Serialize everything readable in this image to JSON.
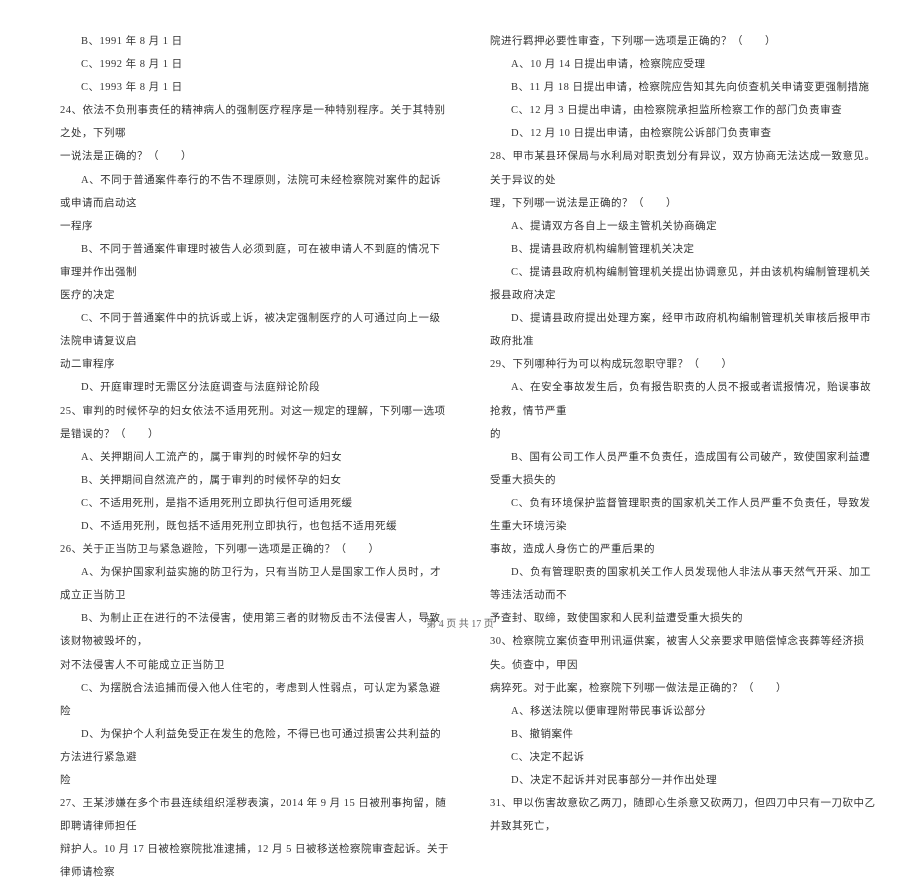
{
  "left_column": {
    "lines": [
      {
        "text": "B、1991 年 8 月 1 日",
        "indent": 1
      },
      {
        "text": "C、1992 年 8 月 1 日",
        "indent": 1
      },
      {
        "text": "C、1993 年 8 月 1 日",
        "indent": 1
      },
      {
        "text": "24、依法不负刑事责任的精神病人的强制医疗程序是一种特别程序。关于其特别之处，下列哪",
        "indent": 2
      },
      {
        "text": "一说法是正确的？（　　）",
        "indent": 2
      },
      {
        "text": "A、不同于普通案件奉行的不告不理原则，法院可未经检察院对案件的起诉或申请而启动这",
        "indent": 1
      },
      {
        "text": "一程序",
        "indent": 2
      },
      {
        "text": "B、不同于普通案件审理时被告人必须到庭，可在被申请人不到庭的情况下审理并作出强制",
        "indent": 1
      },
      {
        "text": "医疗的决定",
        "indent": 2
      },
      {
        "text": "C、不同于普通案件中的抗诉或上诉，被决定强制医疗的人可通过向上一级法院申请复议启",
        "indent": 1
      },
      {
        "text": "动二审程序",
        "indent": 2
      },
      {
        "text": "D、开庭审理时无需区分法庭调查与法庭辩论阶段",
        "indent": 1
      },
      {
        "text": "25、审判的时候怀孕的妇女依法不适用死刑。对这一规定的理解，下列哪一选项是错误的？（　　）",
        "indent": 2
      },
      {
        "text": "A、关押期间人工流产的，属于审判的时候怀孕的妇女",
        "indent": 1
      },
      {
        "text": "B、关押期间自然流产的，属于审判的时候怀孕的妇女",
        "indent": 1
      },
      {
        "text": "C、不适用死刑，是指不适用死刑立即执行但可适用死缓",
        "indent": 1
      },
      {
        "text": "D、不适用死刑，既包括不适用死刑立即执行，也包括不适用死缓",
        "indent": 1
      },
      {
        "text": "26、关于正当防卫与紧急避险，下列哪一选项是正确的？（　　）",
        "indent": 2
      },
      {
        "text": "A、为保护国家利益实施的防卫行为，只有当防卫人是国家工作人员时，才成立正当防卫",
        "indent": 1
      },
      {
        "text": "B、为制止正在进行的不法侵害，使用第三者的财物反击不法侵害人，导致该财物被毁坏的，",
        "indent": 1
      },
      {
        "text": "对不法侵害人不可能成立正当防卫",
        "indent": 2
      },
      {
        "text": "C、为摆脱合法追捕而侵入他人住宅的，考虑到人性弱点，可认定为紧急避险",
        "indent": 1
      },
      {
        "text": "D、为保护个人利益免受正在发生的危险，不得已也可通过损害公共利益的方法进行紧急避",
        "indent": 1
      },
      {
        "text": "险",
        "indent": 2
      },
      {
        "text": "27、王某涉嫌在多个市县连续组织淫秽表演，2014 年 9 月 15 日被刑事拘留，随即聘请律师担任",
        "indent": 2
      },
      {
        "text": "辩护人。10 月 17 日被检察院批准逮捕，12 月 5 日被移送检察院审查起诉。关于律师请检察",
        "indent": 2
      }
    ]
  },
  "right_column": {
    "lines": [
      {
        "text": "院进行羁押必要性审查，下列哪一选项是正确的？（　　）",
        "indent": 2
      },
      {
        "text": "A、10 月 14 日提出申请，检察院应受理",
        "indent": 1
      },
      {
        "text": "B、11 月 18 日提出申请，检察院应告知其先向侦查机关申请变更强制措施",
        "indent": 1
      },
      {
        "text": "C、12 月 3 日提出申请，由检察院承担监所检察工作的部门负责审查",
        "indent": 1
      },
      {
        "text": "D、12 月 10 日提出申请，由检察院公诉部门负责审查",
        "indent": 1
      },
      {
        "text": "28、甲市某县环保局与水利局对职责划分有异议，双方协商无法达成一致意见。关于异议的处",
        "indent": 2
      },
      {
        "text": "理，下列哪一说法是正确的？（　　）",
        "indent": 2
      },
      {
        "text": "A、提请双方各自上一级主管机关协商确定",
        "indent": 1
      },
      {
        "text": "B、提请县政府机构编制管理机关决定",
        "indent": 1
      },
      {
        "text": "C、提请县政府机构编制管理机关提出协调意见，并由该机构编制管理机关报县政府决定",
        "indent": 1
      },
      {
        "text": "D、提请县政府提出处理方案，经甲市政府机构编制管理机关审核后报甲市政府批准",
        "indent": 1
      },
      {
        "text": "29、下列哪种行为可以构成玩忽职守罪？（　　）",
        "indent": 2
      },
      {
        "text": "A、在安全事故发生后，负有报告职责的人员不报或者谎报情况，贻误事故抢救，情节严重",
        "indent": 1
      },
      {
        "text": "的",
        "indent": 2
      },
      {
        "text": "B、国有公司工作人员严重不负责任，造成国有公司破产，致使国家利益遭受重大损失的",
        "indent": 1
      },
      {
        "text": "C、负有环境保护监督管理职责的国家机关工作人员严重不负责任，导致发生重大环境污染",
        "indent": 1
      },
      {
        "text": "事故，造成人身伤亡的严重后果的",
        "indent": 2
      },
      {
        "text": "D、负有管理职责的国家机关工作人员发现他人非法从事天然气开采、加工等违法活动而不",
        "indent": 1
      },
      {
        "text": "予查封、取缔，致使国家和人民利益遭受重大损失的",
        "indent": 2
      },
      {
        "text": "30、检察院立案侦查甲刑讯逼供案，被害人父亲要求甲赔偿悼念丧葬等经济损失。侦查中，甲因",
        "indent": 2
      },
      {
        "text": "病猝死。对于此案，检察院下列哪一做法是正确的？（　　）",
        "indent": 2
      },
      {
        "text": "A、移送法院以便审理附带民事诉讼部分",
        "indent": 1
      },
      {
        "text": "B、撤销案件",
        "indent": 1
      },
      {
        "text": "C、决定不起诉",
        "indent": 1
      },
      {
        "text": "D、决定不起诉并对民事部分一并作出处理",
        "indent": 1
      },
      {
        "text": "31、甲以伤害故意砍乙两刀，随即心生杀意又砍两刀，但四刀中只有一刀砍中乙并致其死亡，",
        "indent": 2
      }
    ]
  },
  "footer": {
    "text": "第 4 页 共 17 页"
  }
}
